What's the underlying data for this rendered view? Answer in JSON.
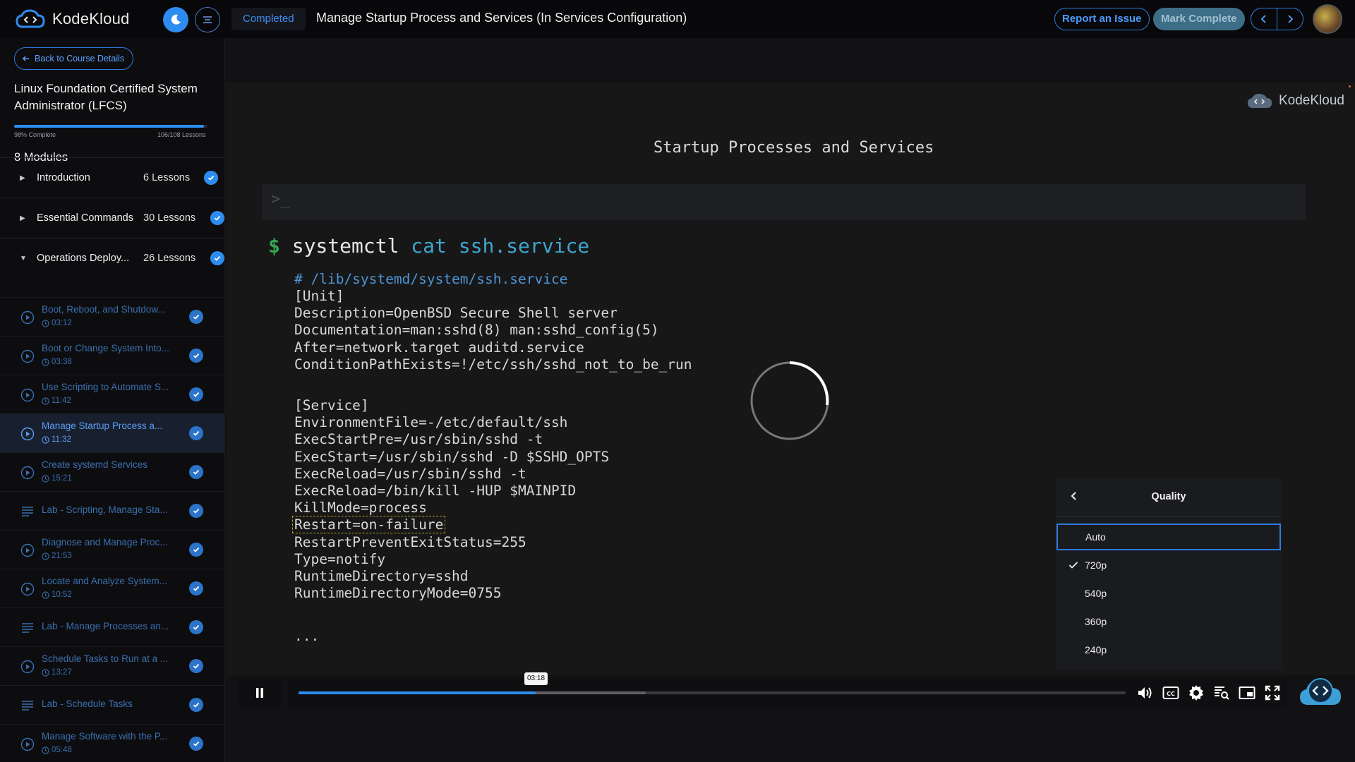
{
  "header": {
    "logo_text": "KodeKloud",
    "status_pill": "Completed",
    "lesson_title": "Manage Startup Process and Services (In Services Configuration)",
    "report_label": "Report an Issue",
    "mark_complete_label": "Mark Complete",
    "accent_color": "#2d8cf0"
  },
  "sidebar": {
    "back_label": "Back to Course Details",
    "course_title": "Linux Foundation Certified System Administrator (LFCS)",
    "progress_percent": 98,
    "progress_left": "98% Complete",
    "progress_right": "106/108 Lessons",
    "modules_count": "8 Modules",
    "modules": [
      {
        "name": "Introduction",
        "count": "6 Lessons",
        "expanded": false
      },
      {
        "name": "Essential Commands",
        "count": "30 Lessons",
        "expanded": false
      },
      {
        "name": "Operations Deploy...",
        "count": "26 Lessons",
        "expanded": true
      }
    ],
    "lessons": [
      {
        "title": "Boot, Reboot, and Shutdow...",
        "time": "03:12",
        "type": "video"
      },
      {
        "title": "Boot or Change System Into...",
        "time": "03:38",
        "type": "video"
      },
      {
        "title": "Use Scripting to Automate S...",
        "time": "11:42",
        "type": "video"
      },
      {
        "title": "Manage Startup Process a...",
        "time": "11:32",
        "type": "video",
        "active": true
      },
      {
        "title": "Create systemd Services",
        "time": "15:21",
        "type": "video"
      },
      {
        "title": "Lab - Scripting, Manage Sta...",
        "time": "",
        "type": "lab"
      },
      {
        "title": "Diagnose and Manage Proc...",
        "time": "21:53",
        "type": "video"
      },
      {
        "title": "Locate and Analyze System...",
        "time": "10:52",
        "type": "video"
      },
      {
        "title": "Lab - Manage Processes an...",
        "time": "",
        "type": "lab"
      },
      {
        "title": "Schedule Tasks to Run at a ...",
        "time": "13:27",
        "type": "video"
      },
      {
        "title": "Lab - Schedule Tasks",
        "time": "",
        "type": "lab"
      },
      {
        "title": "Manage Software with the P...",
        "time": "05:48",
        "type": "video"
      }
    ]
  },
  "video": {
    "watermark": "KodeKloud",
    "heading": "Startup Processes and Services",
    "prompt": ">_",
    "cmd_dollar": "$",
    "cmd_main": "systemctl",
    "cmd_args": "cat ssh.service",
    "code_comment": "# /lib/systemd/system/ssh.service",
    "code_lines": [
      "[Unit]",
      "Description=OpenBSD Secure Shell server",
      "Documentation=man:sshd(8) man:sshd_config(5)",
      "After=network.target auditd.service",
      "ConditionPathExists=!/etc/ssh/sshd_not_to_be_run"
    ],
    "service_lines": [
      "[Service]",
      "EnvironmentFile=-/etc/default/ssh",
      "ExecStartPre=/usr/sbin/sshd -t",
      "ExecStart=/usr/sbin/sshd -D $SSHD_OPTS",
      "ExecReload=/usr/sbin/sshd -t",
      "ExecReload=/bin/kill -HUP $MAINPID",
      "KillMode=process",
      "Restart=on-failure",
      "RestartPreventExitStatus=255",
      "Type=notify",
      "RuntimeDirectory=sshd",
      "RuntimeDirectoryMode=0755"
    ],
    "ellipsis": "...",
    "time_tooltip": "03:18",
    "played_fraction": 0.287,
    "buffered_fraction": 0.42
  },
  "quality_menu": {
    "title": "Quality",
    "options": [
      "Auto",
      "720p",
      "540p",
      "360p",
      "240p"
    ],
    "selected": "720p",
    "focused": "Auto"
  }
}
